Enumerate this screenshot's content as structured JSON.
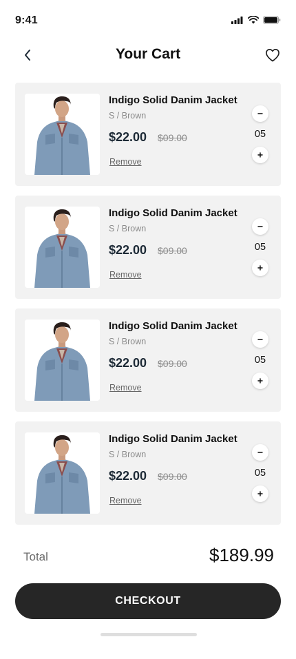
{
  "status_bar": {
    "time": "9:41"
  },
  "header": {
    "title": "Your Cart",
    "back_icon": "chevron-left-icon",
    "wishlist_icon": "heart-icon"
  },
  "cart": {
    "items": [
      {
        "name": "Indigo Solid Danim Jacket",
        "variant": "S / Brown",
        "price": "$22.00",
        "old_price": "$09.00",
        "remove_label": "Remove",
        "quantity": "05"
      },
      {
        "name": "Indigo Solid Danim Jacket",
        "variant": "S / Brown",
        "price": "$22.00",
        "old_price": "$09.00",
        "remove_label": "Remove",
        "quantity": "05"
      },
      {
        "name": "Indigo Solid Danim Jacket",
        "variant": "S / Brown",
        "price": "$22.00",
        "old_price": "$09.00",
        "remove_label": "Remove",
        "quantity": "05"
      },
      {
        "name": "Indigo Solid Danim Jacket",
        "variant": "S / Brown",
        "price": "$22.00",
        "old_price": "$09.00",
        "remove_label": "Remove",
        "quantity": "05"
      }
    ]
  },
  "summary": {
    "total_label": "Total",
    "total_value": "$189.99"
  },
  "checkout": {
    "label": "CHECKOUT"
  },
  "colors": {
    "card_bg": "#f2f2f2",
    "button_bg": "#262626",
    "price": "#1d2a36",
    "muted": "#8a8a8a"
  }
}
